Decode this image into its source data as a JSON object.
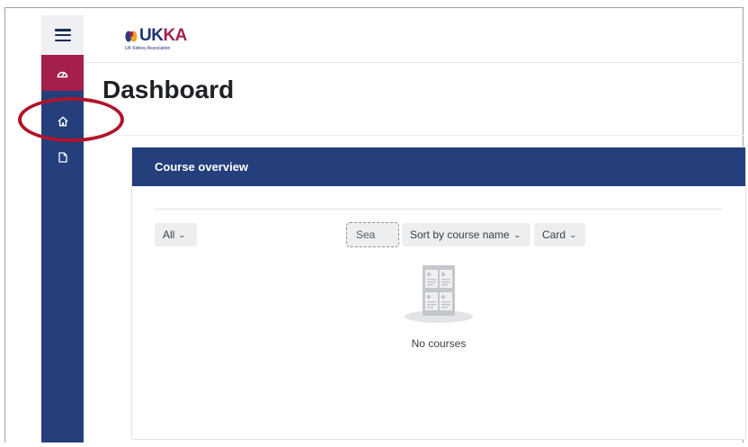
{
  "brand": {
    "logo_text_a": "UK",
    "logo_text_b": "KA",
    "logo_subtitle": "UK Kidney Association",
    "primary_color": "#243f7b",
    "accent_color": "#a51f4d"
  },
  "sidebar": {
    "items": [
      {
        "name": "menu-toggle",
        "icon": "hamburger-icon"
      },
      {
        "name": "dashboard",
        "icon": "gauge-icon",
        "active": true
      },
      {
        "name": "home",
        "icon": "home-icon"
      },
      {
        "name": "files",
        "icon": "file-icon"
      }
    ]
  },
  "page": {
    "title": "Dashboard"
  },
  "course_overview": {
    "header": "Course overview",
    "filter_label": "All",
    "search_placeholder": "Sea",
    "sort_label": "Sort by course name",
    "view_label": "Card",
    "empty_message": "No courses"
  },
  "annotation": {
    "shape": "ellipse",
    "color": "#b0142a",
    "target": "home"
  }
}
